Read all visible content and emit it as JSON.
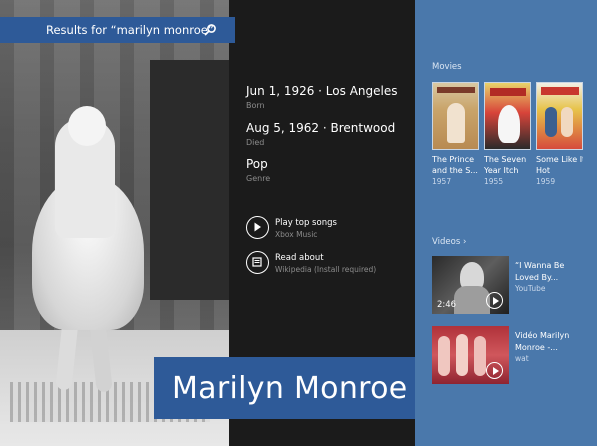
{
  "search": {
    "label": "Results for “marilyn monroe”"
  },
  "facts": [
    {
      "value": "Jun 1, 1926 · Los Angeles",
      "caption": "Born"
    },
    {
      "value": "Aug 5, 1962 · Brentwood",
      "caption": "Died"
    },
    {
      "value": "Pop",
      "caption": "Genre"
    }
  ],
  "actions": [
    {
      "label": "Play top songs",
      "sub": "Xbox Music",
      "icon": "play-icon"
    },
    {
      "label": "Read about",
      "sub": "Wikipedia (Install required)",
      "icon": "book-icon"
    }
  ],
  "name": "Marilyn Monroe",
  "movies": {
    "title": "Movies",
    "items": [
      {
        "title_line1": "The Prince",
        "title_line2": "and the S...",
        "year": "1957"
      },
      {
        "title_line1": "The Seven",
        "title_line2": "Year Itch",
        "year": "1955"
      },
      {
        "title_line1": "Some Like It",
        "title_line2": "Hot",
        "year": "1959"
      }
    ]
  },
  "videos": {
    "title": "Videos ›",
    "items": [
      {
        "title_line1": "“I Wanna Be",
        "title_line2": "Loved By...",
        "source": "YouTube",
        "duration": "2:46"
      },
      {
        "title_line1": "Vidéo Marilyn",
        "title_line2": "Monroe -...",
        "source": "wat",
        "duration": ""
      }
    ]
  },
  "colors": {
    "accent": "#2e5a98",
    "panel": "#4a78ab",
    "background": "#1b1b1b"
  }
}
